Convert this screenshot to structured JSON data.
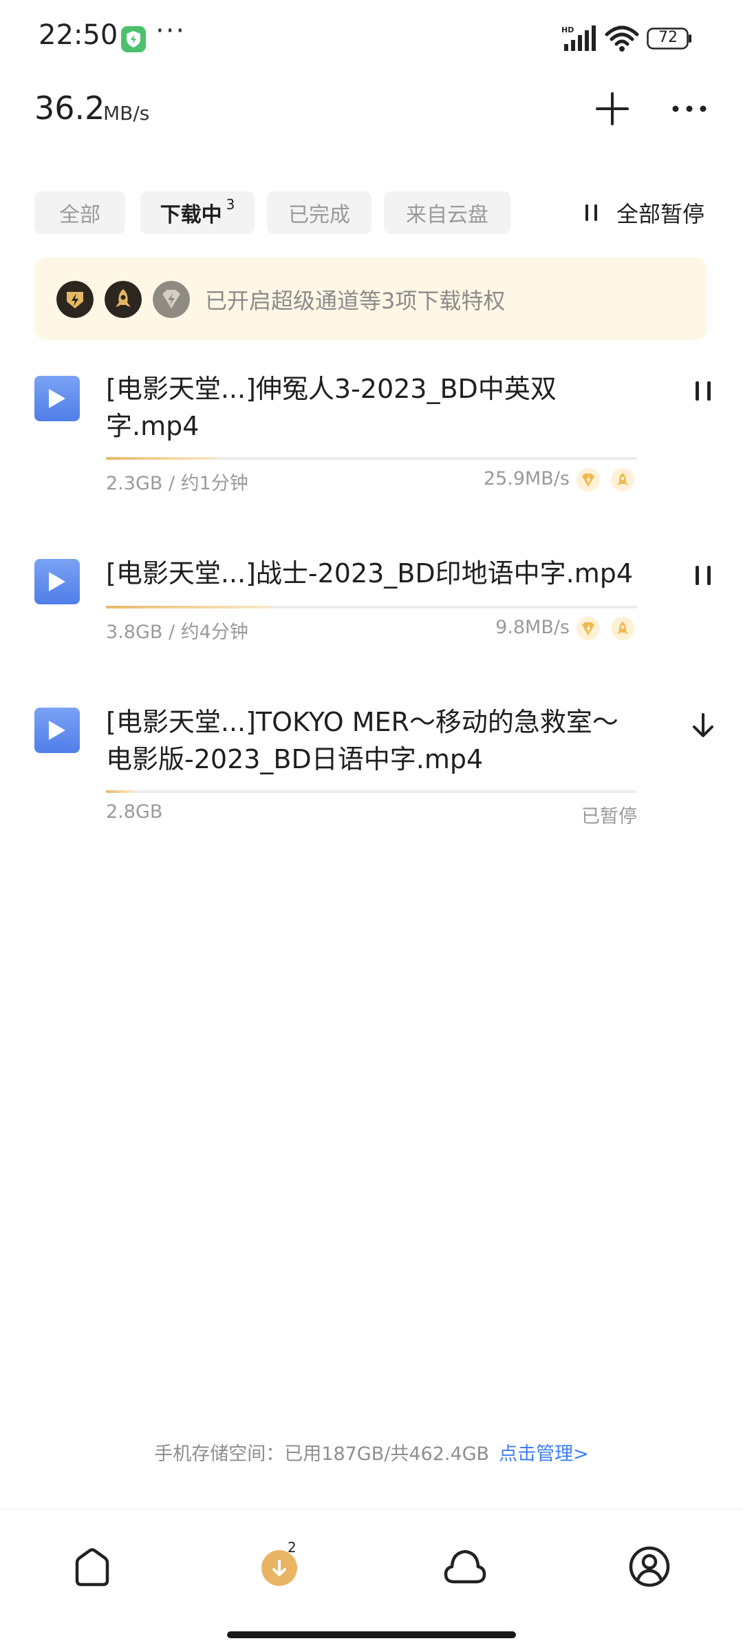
{
  "status_bar": {
    "time": "22:50",
    "dots": "···",
    "battery": "72",
    "icons": [
      "shield-icon",
      "signal-icon",
      "wifi-icon",
      "battery-icon"
    ]
  },
  "header": {
    "speed_value": "36.2",
    "speed_unit": "MB/s",
    "icons": [
      "plus-icon",
      "more-icon"
    ]
  },
  "tabs": [
    {
      "label": "全部",
      "active": false
    },
    {
      "label": "下载中",
      "count": "3",
      "active": true
    },
    {
      "label": "已完成",
      "active": false
    },
    {
      "label": "来自云盘",
      "active": false
    }
  ],
  "pause_all_label": "全部暂停",
  "banner": {
    "text": "已开启超级通道等3项下载特权",
    "badges": [
      "lightning-badge-icon",
      "rocket-badge-icon",
      "speed-badge-icon"
    ]
  },
  "downloads": [
    {
      "title": "[电影天堂...]伸冤人3-2023_BD中英双字.mp4",
      "size": "2.3GB / 约1分钟",
      "speed": "25.9MB/s",
      "progress": 0.21,
      "action_icon": "pause-icon"
    },
    {
      "title": "[电影天堂...]战士-2023_BD印地语中字.mp4",
      "size": "3.8GB / 约4分钟",
      "speed": "9.8MB/s",
      "progress": 0.31,
      "action_icon": "pause-icon"
    },
    {
      "title": "[电影天堂...]TOKYO MER～移动的急救室～电影版-2023_BD日语中字.mp4",
      "size": "2.8GB",
      "status": "已暂停",
      "progress": 0.055,
      "action_icon": "download-icon"
    }
  ],
  "storage": {
    "text": "手机存储空间：已用187GB/共462.4GB",
    "link": "点击管理>"
  },
  "bottom_nav": {
    "download_badge": "2",
    "items": [
      "home-icon",
      "download-icon",
      "cloud-icon",
      "profile-icon"
    ]
  },
  "colors": {
    "accent_gold": "#e7b869",
    "link_blue": "#3c7ff6",
    "banner_bg": "#fff7e6",
    "file_icon_blue": "#5a86ec"
  }
}
